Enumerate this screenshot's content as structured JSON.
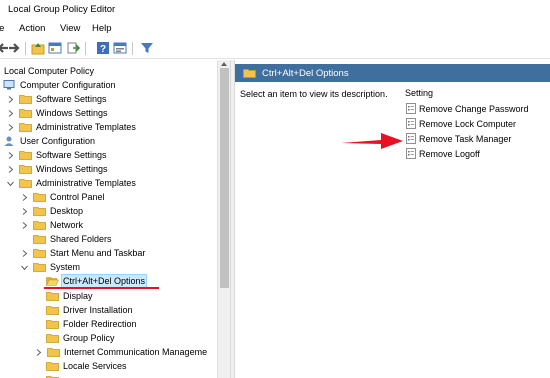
{
  "window": {
    "title": "Local Group Policy Editor"
  },
  "menu": {
    "items": [
      "le",
      "Action",
      "View",
      "Help"
    ]
  },
  "colors": {
    "header_blue": "#3f6f9f",
    "selection": "#cce8ff",
    "annotation_red": "#e81123",
    "folder": "#f3c44b"
  },
  "toolbar": {
    "icons": [
      "back-arrow-icon",
      "forward-arrow-icon",
      "up-folder-icon",
      "show-hide-tree-icon",
      "export-list-icon",
      "help-icon",
      "properties-icon",
      "filter-icon"
    ]
  },
  "tree": {
    "root": "Local Computer Policy",
    "computer_config": "Computer Configuration",
    "cc_software": "Software Settings",
    "cc_windows": "Windows Settings",
    "cc_admin": "Administrative Templates",
    "user_config": "User Configuration",
    "uc_software": "Software Settings",
    "uc_windows": "Windows Settings",
    "uc_admin": "Administrative Templates",
    "control_panel": "Control Panel",
    "desktop": "Desktop",
    "network": "Network",
    "shared_folders": "Shared Folders",
    "start_menu": "Start Menu and Taskbar",
    "system": "System",
    "ctrl_alt_del": "Ctrl+Alt+Del Options",
    "display": "Display",
    "driver_installation": "Driver Installation",
    "folder_redirection": "Folder Redirection",
    "group_policy": "Group Policy",
    "internet_comm": "Internet Communication Manageme",
    "locale_services": "Locale Services"
  },
  "details": {
    "header": "Ctrl+Alt+Del Options",
    "description": "Select an item to view its description.",
    "column": "Setting",
    "settings": [
      "Remove Change Password",
      "Remove Lock Computer",
      "Remove Task Manager",
      "Remove Logoff"
    ]
  }
}
